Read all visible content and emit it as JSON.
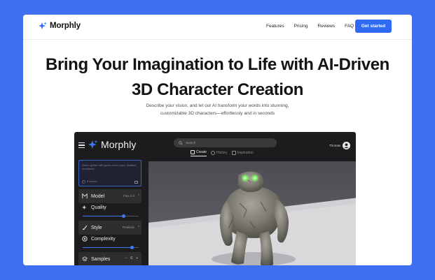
{
  "nav": {
    "logo_text": "Morphly",
    "links": [
      "Features",
      "Pricing",
      "Reviews",
      "FAQ"
    ],
    "cta_label": "Get started"
  },
  "hero": {
    "title_line1": "Bring Your Imagination to Life with AI-Driven",
    "title_line2": "3D Character Creation",
    "subtitle_line1": "Describe your vision, and let our AI transform your words into stunning,",
    "subtitle_line2": "customizable 3D characters—effortlessly and in seconds"
  },
  "app": {
    "logo_text": "Morphly",
    "search_placeholder": "Search",
    "tabs": [
      "Create",
      "History",
      "Inspiration"
    ],
    "user_name": "Thomas",
    "prompt_text": "Stone golem with green neon eyes, realistic, humanoid",
    "prompt_enhance": "Enhance",
    "sidebar": {
      "model_label": "Model",
      "model_value": "Flux 2.0",
      "quality_label": "Quality",
      "quality_level": 0.72,
      "style_label": "Style",
      "style_value": "Realistic",
      "complexity_label": "Complexity",
      "complexity_level": 0.88,
      "samples_label": "Samples",
      "samples_value": "6",
      "minus": "−",
      "plus": "+"
    }
  },
  "colors": {
    "page_bg": "#3f6ff0",
    "accent": "#2f6bf2",
    "app_bg": "#1c1c1e",
    "eye_glow": "#7dff6a"
  }
}
